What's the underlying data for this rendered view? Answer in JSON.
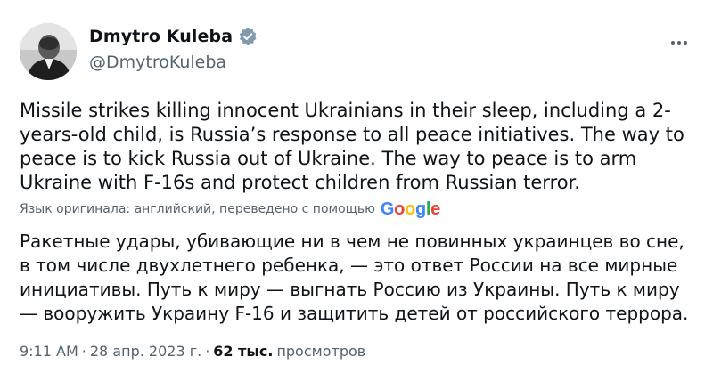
{
  "author": {
    "name": "Dmytro Kuleba",
    "handle": "@DmytroKuleba",
    "verified_color": "#829aab"
  },
  "more_icon": "more-icon",
  "tweet": {
    "text": "Missile strikes killing innocent Ukrainians in their sleep, including a 2-years-old child, is Russia’s response to all peace initiatives. The way to peace is to kick Russia out of Ukraine. The way to peace is to arm Ukraine with F-16s and protect children from Russian terror.",
    "translation_note": "Язык оригинала: английский, переведено с помощью",
    "translation_provider": [
      "G",
      "o",
      "o",
      "g",
      "l",
      "e"
    ],
    "translated_text": "Ракетные удары, убивающие ни в чем не повинных украинцев во сне, в том числе двухлетнего ребенка, — это ответ России на все мирные инициативы. Путь к миру — выгнать Россию из Украины. Путь к миру — вооружить Украину F-16 и защитить детей от российского террора."
  },
  "meta": {
    "time": "9:11 AM",
    "separator": "·",
    "date": "28 апр. 2023 г.",
    "views_count": "62 тыс.",
    "views_label": "просмотров"
  },
  "colors": {
    "text": "#0f1419",
    "secondary": "#536471",
    "google_blue": "#4285F4",
    "google_red": "#EA4335",
    "google_yellow": "#FBBC05",
    "google_green": "#34A853"
  }
}
